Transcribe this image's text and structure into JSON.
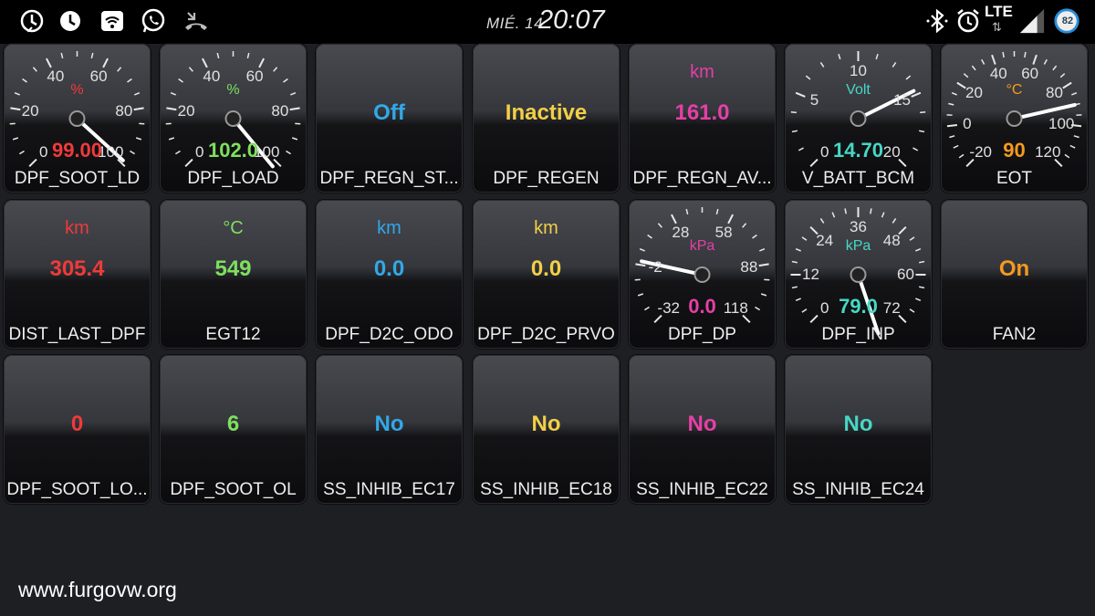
{
  "statusbar": {
    "left_icons": [
      "clock-download-icon",
      "clock-download-icon",
      "wifi-icon",
      "whatsapp-icon",
      "missed-call-icon"
    ],
    "date": "MIÉ. 14",
    "time": "20:07",
    "network_type": "LTE",
    "network_arrows": "⇅",
    "battery_level": "82",
    "right_icons": [
      "bluetooth-icon",
      "alarm-icon",
      "signal-icon",
      "battery-icon"
    ]
  },
  "tiles": [
    {
      "kind": "gauge",
      "label": "DPF_SOOT_LD",
      "unit": "%",
      "value": "99.00",
      "color": "#f03a3a",
      "ticks": [
        "0",
        "20",
        "40",
        "60",
        "80",
        "100"
      ],
      "needle": 0.99
    },
    {
      "kind": "gauge",
      "label": "DPF_LOAD",
      "unit": "%",
      "value": "102.0",
      "color": "#7ee05e",
      "ticks": [
        "0",
        "20",
        "40",
        "60",
        "80",
        "100"
      ],
      "needle": 1.02
    },
    {
      "kind": "text",
      "label": "DPF_REGN_ST...",
      "unit": "",
      "value": "Off",
      "color": "#32a8e8"
    },
    {
      "kind": "text",
      "label": "DPF_REGEN",
      "unit": "",
      "value": "Inactive",
      "color": "#f2cf47"
    },
    {
      "kind": "text",
      "label": "DPF_REGN_AV...",
      "unit": "km",
      "value": "161.0",
      "color": "#e63fa6"
    },
    {
      "kind": "gauge",
      "label": "V_BATT_BCM",
      "unit": "Volt",
      "value": "14.70",
      "color": "#46d8c4",
      "ticks": [
        "0",
        "5",
        "10",
        "15",
        "20"
      ],
      "needle": 0.735
    },
    {
      "kind": "gauge",
      "label": "EOT",
      "unit": "°C",
      "value": "90",
      "color": "#f59a1e",
      "ticks": [
        "-20",
        "0",
        "20",
        "40",
        "60",
        "80",
        "100",
        "120"
      ],
      "needle": 0.786
    },
    {
      "kind": "text",
      "label": "DIST_LAST_DPF",
      "unit": "km",
      "value": "305.4",
      "color": "#f03a3a"
    },
    {
      "kind": "text",
      "label": "EGT12",
      "unit": "°C",
      "value": "549",
      "color": "#7ee05e"
    },
    {
      "kind": "text",
      "label": "DPF_D2C_ODO",
      "unit": "km",
      "value": "0.0",
      "color": "#32a8e8"
    },
    {
      "kind": "text",
      "label": "DPF_D2C_PRVO",
      "unit": "km",
      "value": "0.0",
      "color": "#f2cf47"
    },
    {
      "kind": "gauge",
      "label": "DPF_DP",
      "unit": "kPa",
      "value": "0.0",
      "color": "#e63fa6",
      "ticks": [
        "-32",
        "-2",
        "28",
        "58",
        "88",
        "118"
      ],
      "needle": 0.213
    },
    {
      "kind": "gauge",
      "label": "DPF_INP",
      "unit": "kPa",
      "value": "79.0",
      "color": "#46d8c4",
      "ticks": [
        "0",
        "12",
        "24",
        "36",
        "48",
        "60",
        "72"
      ],
      "needle": 1.097
    },
    {
      "kind": "text",
      "label": "FAN2",
      "unit": "",
      "value": "On",
      "color": "#f59a1e"
    },
    {
      "kind": "text",
      "label": "DPF_SOOT_LO...",
      "unit": "",
      "value": "0",
      "color": "#f03a3a"
    },
    {
      "kind": "text",
      "label": "DPF_SOOT_OL",
      "unit": "",
      "value": "6",
      "color": "#7ee05e"
    },
    {
      "kind": "text",
      "label": "SS_INHIB_EC17",
      "unit": "",
      "value": "No",
      "color": "#32a8e8"
    },
    {
      "kind": "text",
      "label": "SS_INHIB_EC18",
      "unit": "",
      "value": "No",
      "color": "#f2cf47"
    },
    {
      "kind": "text",
      "label": "SS_INHIB_EC22",
      "unit": "",
      "value": "No",
      "color": "#e63fa6"
    },
    {
      "kind": "text",
      "label": "SS_INHIB_EC24",
      "unit": "",
      "value": "No",
      "color": "#46d8c4"
    }
  ],
  "watermark": "www.furgovw.org"
}
